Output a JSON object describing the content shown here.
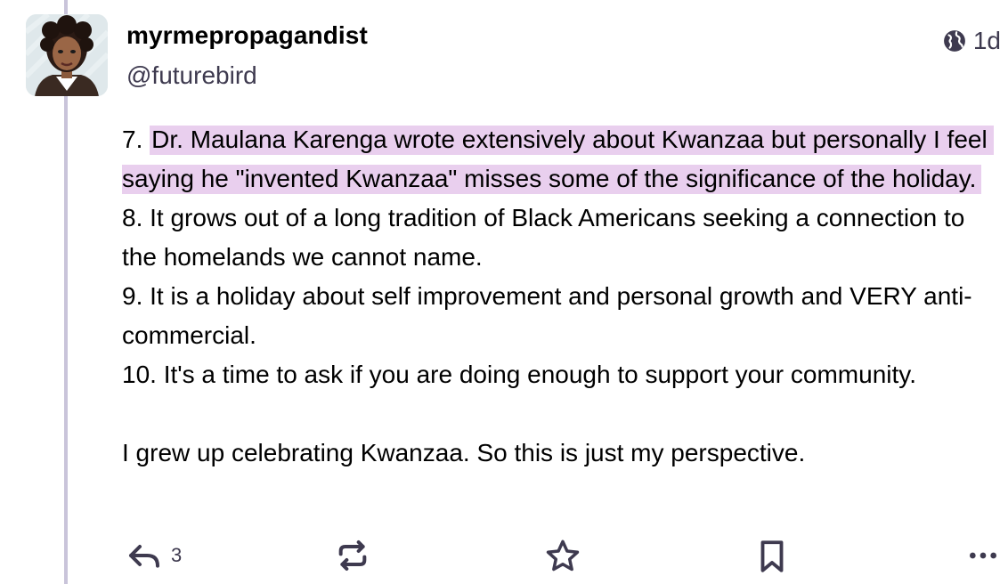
{
  "post": {
    "author": {
      "display_name": "myrmepropagandist",
      "handle": "@futurebird"
    },
    "time": "1d",
    "visibility_icon": "globe-icon",
    "highlight_color": "#e9cfee",
    "content": {
      "item7_number": "7. ",
      "item7_highlight": "Dr. Maulana Karenga wrote extensively about Kwanzaa but personally I feel saying he \"invented Kwanzaa\" misses some of the significance of the holiday.",
      "item8": "8. It grows out of a long tradition of Black Americans seeking a connection to the homelands we cannot name.",
      "item9": "9. It is a holiday about self improvement and personal growth and VERY anti-commercial.",
      "item10": "10. It's a time to ask if you are doing enough to support your community.",
      "closing": "I grew up celebrating Kwanzaa. So this is just my perspective."
    },
    "actions": {
      "reply_count": "3",
      "icons": [
        "reply-icon",
        "boost-icon",
        "favourite-icon",
        "bookmark-icon",
        "more-icon"
      ]
    }
  }
}
